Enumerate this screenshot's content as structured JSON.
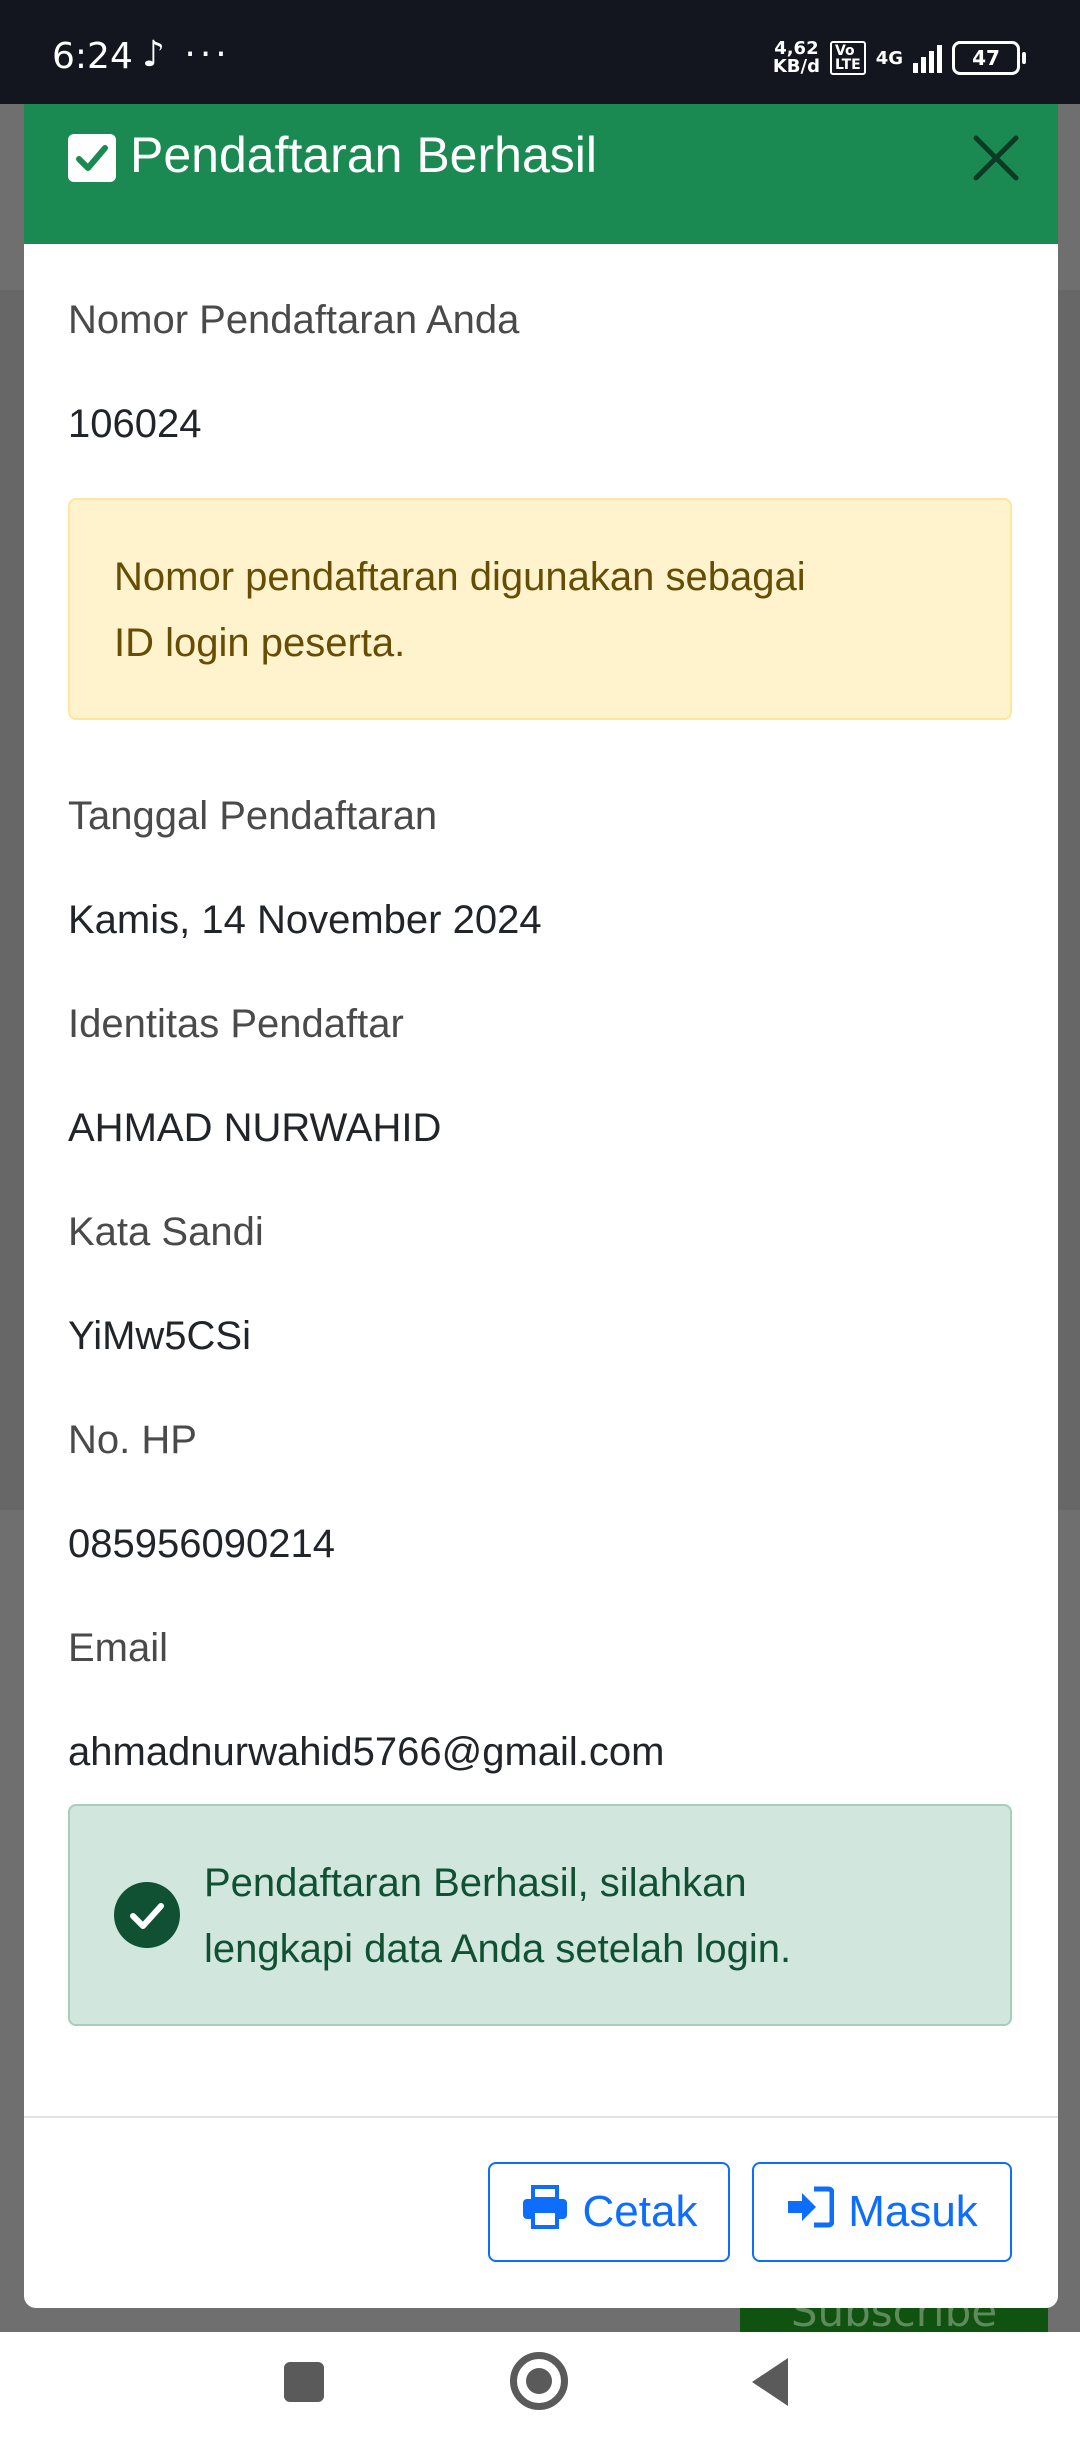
{
  "status_bar": {
    "time": "6:24",
    "extra_icons": "♪ ···",
    "net_speed": "4,62 KB/d",
    "volte": "Vo LTE",
    "network": "4G",
    "battery": "47"
  },
  "modal": {
    "title": "Pendaftaran Berhasil",
    "fields": {
      "nomor_label": "Nomor Pendaftaran Anda",
      "nomor_value": "106024",
      "tanggal_label": "Tanggal Pendaftaran",
      "tanggal_value": "Kamis, 14 November 2024",
      "identitas_label": "Identitas Pendaftar",
      "identitas_value": "AHMAD NURWAHID",
      "sandi_label": "Kata Sandi",
      "sandi_value": "YiMw5CSi",
      "hp_label": "No. HP",
      "hp_value": "085956090214",
      "email_label": "Email",
      "email_value": "ahmadnurwahid5766@gmail.com"
    },
    "warning_line1": "Nomor pendaftaran digunakan sebagai",
    "warning_line2": "ID login peserta.",
    "success_line1": "Pendaftaran Berhasil, silahkan",
    "success_line2": "lengkapi data Anda setelah login.",
    "buttons": {
      "print": "Cetak",
      "login": "Masuk"
    }
  },
  "background": {
    "subscribe": "Subscribe"
  },
  "colors": {
    "header": "#1b8a52",
    "primary": "#0d6efd",
    "warning_bg": "#fff3cd",
    "success_bg": "#d1e7dd"
  }
}
